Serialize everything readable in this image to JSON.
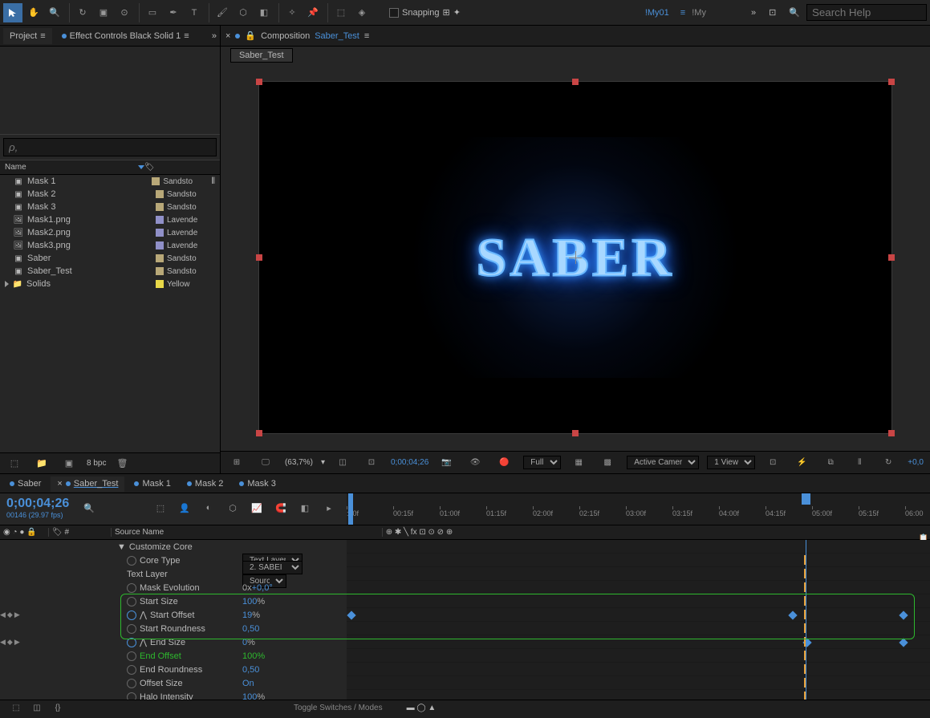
{
  "toolbar": {
    "snapping_label": "Snapping",
    "workspace1": "!My01",
    "workspace2": "!My",
    "search_placeholder": "Search Help"
  },
  "project": {
    "tab_project": "Project",
    "tab_effect": "Effect Controls Black Solid 1",
    "search_placeholder": "ρ,",
    "col_name": "Name",
    "bpc": "8 bpc",
    "items": [
      {
        "name": "Mask 1",
        "type": "comp",
        "label": "Sandsto",
        "color": "#b8a878",
        "flow": true
      },
      {
        "name": "Mask 2",
        "type": "comp",
        "label": "Sandsto",
        "color": "#b8a878"
      },
      {
        "name": "Mask 3",
        "type": "comp",
        "label": "Sandsto",
        "color": "#b8a878"
      },
      {
        "name": "Mask1.png",
        "type": "png",
        "label": "Lavende",
        "color": "#9090c8"
      },
      {
        "name": "Mask2.png",
        "type": "png",
        "label": "Lavende",
        "color": "#9090c8"
      },
      {
        "name": "Mask3.png",
        "type": "png",
        "label": "Lavende",
        "color": "#9090c8"
      },
      {
        "name": "Saber",
        "type": "comp",
        "label": "Sandsto",
        "color": "#b8a878"
      },
      {
        "name": "Saber_Test",
        "type": "comp",
        "label": "Sandsto",
        "color": "#b8a878"
      },
      {
        "name": "Solids",
        "type": "folder",
        "label": "Yellow",
        "color": "#e8d848"
      }
    ]
  },
  "comp": {
    "label": "Composition",
    "name": "Saber_Test",
    "subtab": "Saber_Test",
    "text": "SABER",
    "controls": {
      "zoom": "(63,7%)",
      "time": "0;00;04;26",
      "res": "Full",
      "camera": "Active Camera",
      "view": "1 View",
      "exposure": "+0,0"
    }
  },
  "tl": {
    "tabs": [
      "Saber",
      "Saber_Test",
      "Mask 1",
      "Mask 2",
      "Mask 3"
    ],
    "active_tab": 1,
    "timecode": "0;00;04;26",
    "subframe": "00146 (29.97 fps)",
    "col_num": "#",
    "col_source": "Source Name",
    "ticks": [
      ":00f",
      "00:15f",
      "01:00f",
      "01:15f",
      "02:00f",
      "02:15f",
      "03:00f",
      "03:15f",
      "04:00f",
      "04:15f",
      "05:00f",
      "05:15f",
      "06:00"
    ],
    "props": {
      "customize": "Customize Core",
      "core_type": {
        "label": "Core Type",
        "value": "Text Layer"
      },
      "text_layer": {
        "label": "Text Layer",
        "value": "2. SABEI",
        "value2": "Source"
      },
      "mask_evo": {
        "label": "Mask Evolution",
        "prefix": "0x",
        "value": "+0,0°"
      },
      "start_size": {
        "label": "Start Size",
        "value": "100",
        "unit": "%"
      },
      "start_offset": {
        "label": "Start Offset",
        "value": "19",
        "unit": "%"
      },
      "start_round": {
        "label": "Start Roundness",
        "value": "0,50"
      },
      "end_size": {
        "label": "End Size",
        "value": "0",
        "unit": "%"
      },
      "end_offset": {
        "label": "End Offset",
        "value": "100",
        "unit": "%"
      },
      "end_round": {
        "label": "End Roundness",
        "value": "0,50"
      },
      "offset_size": {
        "label": "Offset Size",
        "value": "On"
      },
      "halo": {
        "label": "Halo Intensity",
        "value": "100",
        "unit": "%"
      }
    },
    "toggle": "Toggle Switches / Modes"
  }
}
